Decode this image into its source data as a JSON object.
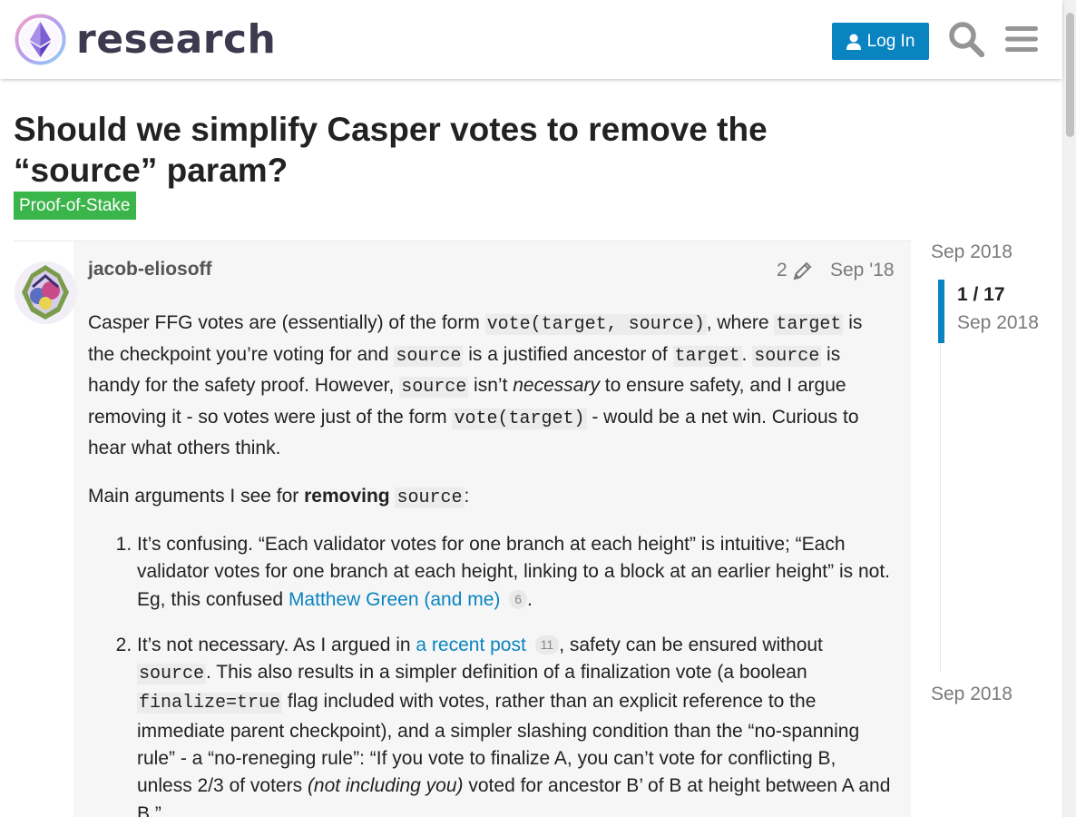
{
  "header": {
    "logo_text": "research",
    "login_label": "Log In",
    "search_icon": "search-icon",
    "menu_icon": "hamburger-menu-icon",
    "brand_color": "#0a84c1"
  },
  "topic": {
    "title": "Should we simplify Casper votes to remove the “source” param?",
    "category": "Proof-of-Stake",
    "category_color": "#3ab54a"
  },
  "post": {
    "username": "jacob-eliosoff",
    "edit_count": "2",
    "date": "Sep '18",
    "p1": {
      "t1": "Casper FFG votes are (essentially) of the form ",
      "c1": "vote(target, source)",
      "t2": ", where ",
      "c2": "target",
      "t3": " is the checkpoint you’re voting for and ",
      "c3": "source",
      "t4": " is a justified ancestor of ",
      "c4": "target",
      "t5": ". ",
      "c5": "source",
      "t6": " is handy for the safety proof. However, ",
      "c6": "source",
      "t7": " isn’t ",
      "em1": "necessary",
      "t8": " to ensure safety, and I argue removing it - so votes were just of the form ",
      "c7": "vote(target)",
      "t9": " - would be a net win. Curious to hear what others think."
    },
    "p2": {
      "t1": "Main arguments I see for ",
      "strong": "removing",
      "t2": " ",
      "c1": "source",
      "t3": ":"
    },
    "list": {
      "item1": {
        "t1": "It’s confusing. “Each validator votes for one branch at each height” is intuitive; “Each validator votes for one branch at each height, linking to a block at an earlier height” is not. Eg, this confused ",
        "link": "Matthew Green (and me)",
        "clicks": "6",
        "t2": "."
      },
      "item2": {
        "t1": "It’s not necessary. As I argued in ",
        "link": "a recent post",
        "clicks": "11",
        "t2": ", safety can be ensured without ",
        "c1": "source",
        "t3": ". This also results in a simpler definition of a finalization vote (a boolean ",
        "c2": "finalize=true",
        "t4": " flag included with votes, rather than an explicit reference to the immediate parent checkpoint), and a simpler slashing condition than the “no-spanning rule” - a “no-reneging rule”: “If you vote to finalize A, you can’t vote for conflicting B, unless 2/3 of voters ",
        "em1": "(not including you)",
        "t5": " voted for ancestor B’ of B at height between A and B.”"
      }
    }
  },
  "timeline": {
    "top_date": "Sep 2018",
    "position": "1 / 17",
    "position_date": "Sep 2018",
    "bottom_date": "Sep 2018"
  }
}
